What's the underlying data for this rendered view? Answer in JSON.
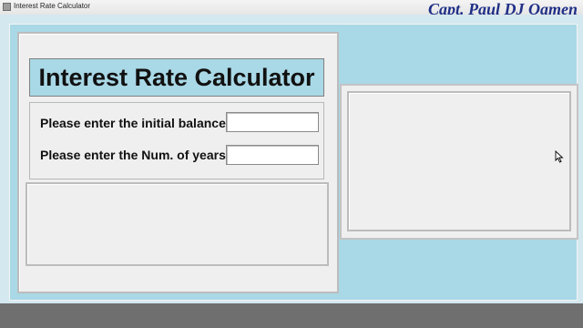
{
  "window": {
    "title": "Interest Rate Calculator",
    "icon": "app-feather-icon"
  },
  "watermark": "Capt. Paul DJ Oamen",
  "header": {
    "title": "Interest Rate Calculator"
  },
  "form": {
    "initial_balance": {
      "label": "Please enter the initial balance:",
      "value": ""
    },
    "num_years": {
      "label": "Please enter the Num. of years:",
      "value": ""
    }
  },
  "cursor": "arrow-cursor-icon",
  "colors": {
    "accent": "#a9d8e6",
    "panel": "#efefef",
    "watermark": "#1f2f86",
    "taskbar": "#6f6f6f"
  }
}
